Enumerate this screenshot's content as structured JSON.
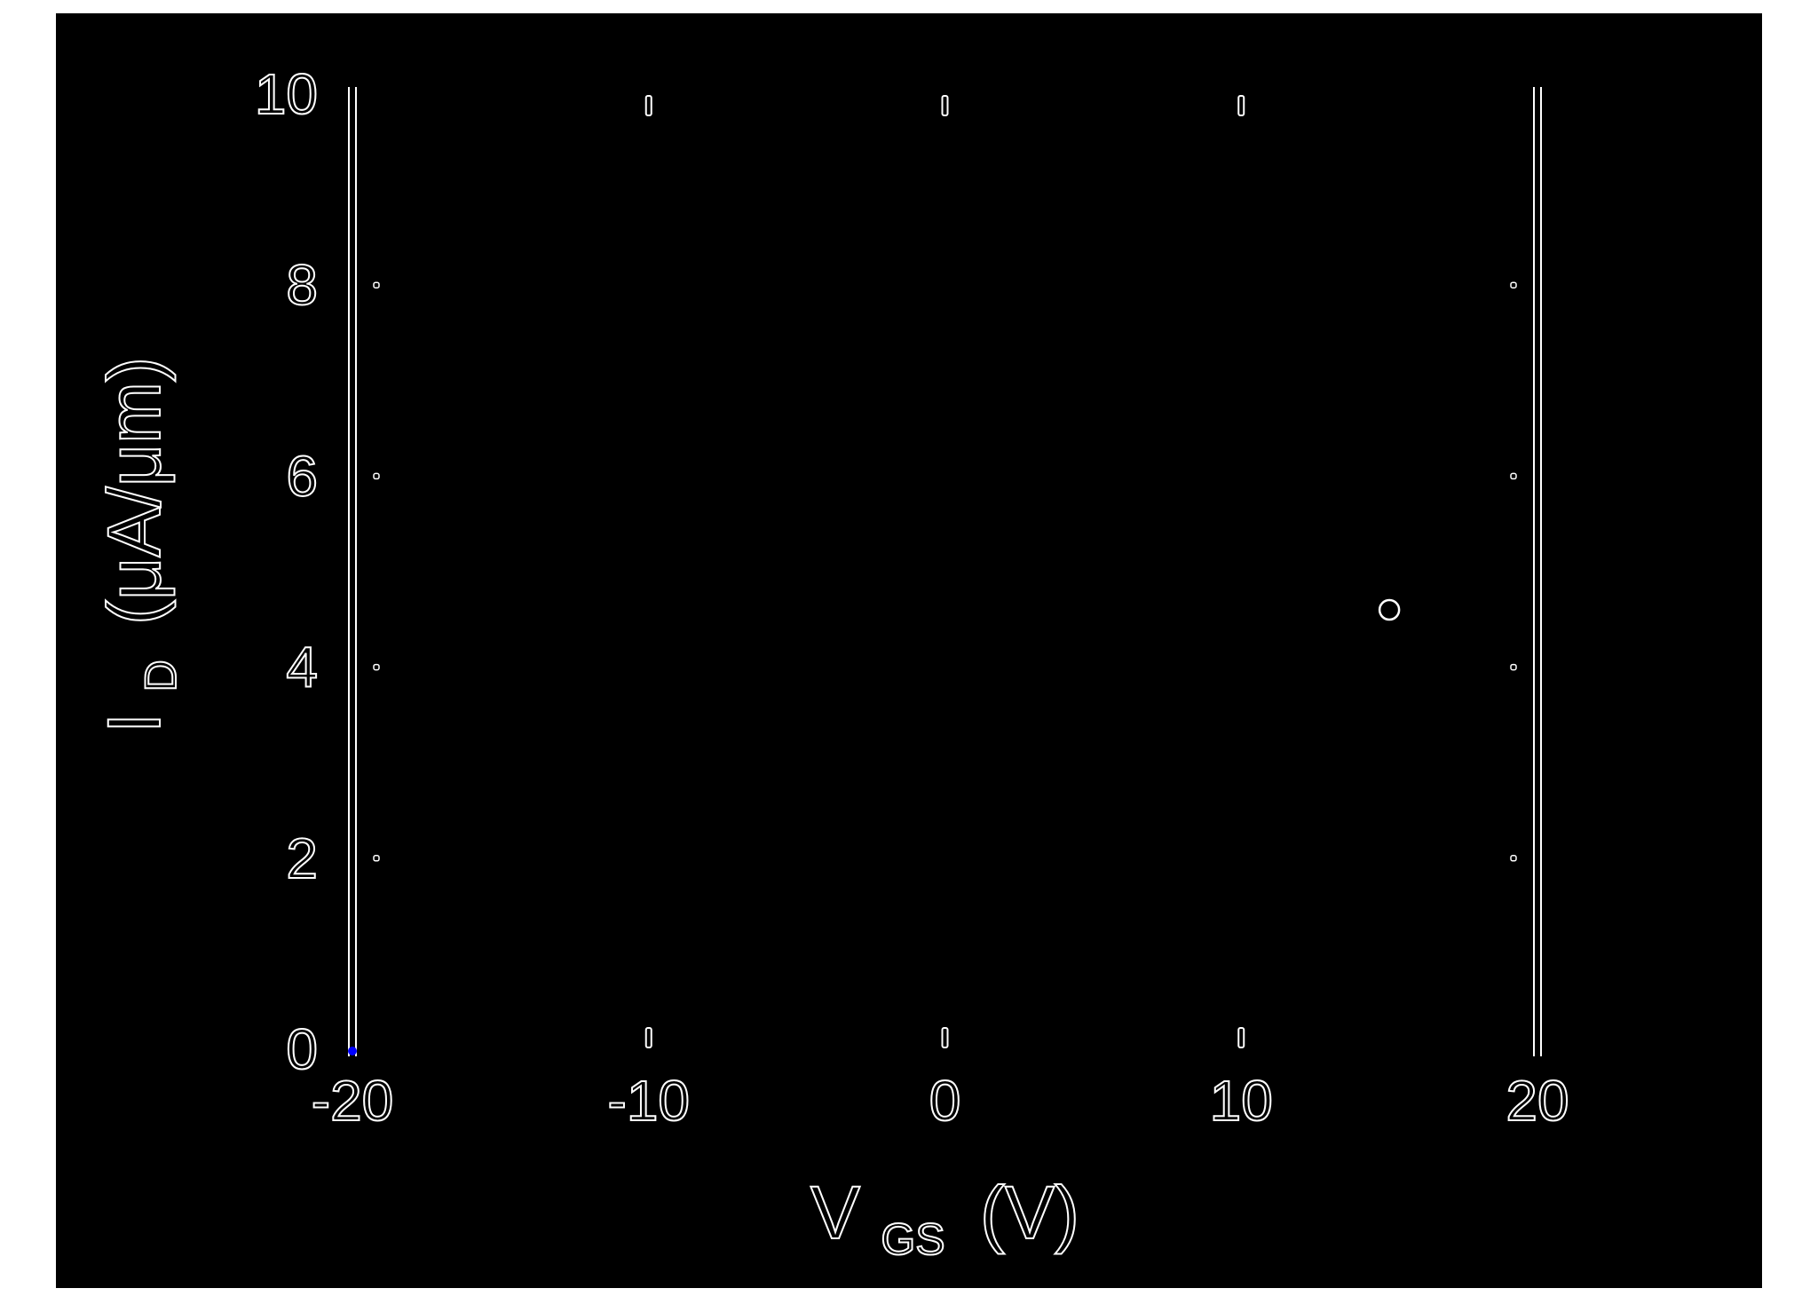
{
  "chart_data": {
    "type": "scatter",
    "title": "",
    "xlabel": {
      "main": "V",
      "sub": "GS",
      "unit": "(V)"
    },
    "ylabel": {
      "main": "I",
      "sub": "D",
      "unit": "(μA/μm)"
    },
    "xlim": [
      -20,
      20
    ],
    "ylim": [
      0,
      10
    ],
    "xticks": [
      -20,
      -10,
      0,
      10,
      20
    ],
    "yticks": [
      0,
      2,
      4,
      6,
      8,
      10
    ],
    "xtick_labels": [
      "-20",
      "-10",
      "0",
      "10",
      "20"
    ],
    "ytick_labels": [
      "0",
      "2",
      "4",
      "6",
      "8",
      "10"
    ],
    "grid": false,
    "legend": "none",
    "series": [
      {
        "points": [
          {
            "x": -20,
            "y": 0
          },
          {
            "x": 15,
            "y": 4.6
          }
        ]
      }
    ],
    "colors": {
      "background": "#000000",
      "outline": "#ffffff",
      "marker_highlight": "#0000ff"
    }
  }
}
